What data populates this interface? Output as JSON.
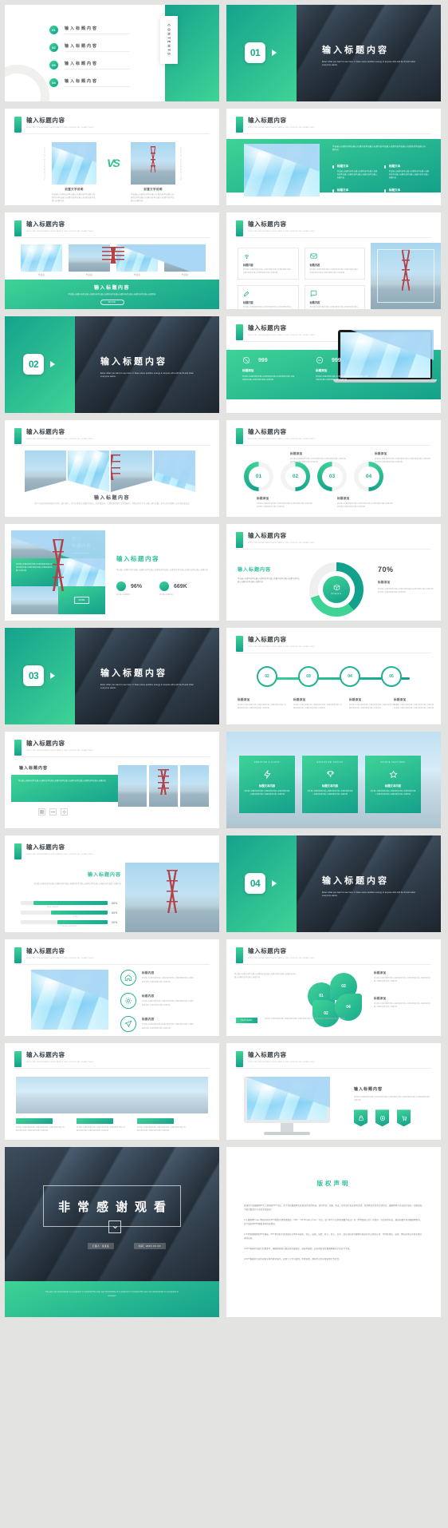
{
  "meta": {
    "accent": "#22b195",
    "accent_dark": "#13a08c",
    "accent_light": "#3fd396",
    "page_bg": "#e3e3e1"
  },
  "common": {
    "title_cn": "输入标题内容",
    "subtitle_en": "enter the presentation and make it into a forms for reader here",
    "caption_cn": "标题内容",
    "label_cn": "前置文字说明",
    "body_cn": "单击输入标题内容单击输入标题内容单击输入标题内容单击输入标题内容单击输入标题内容单击输入标题内容",
    "body_en": "Enter what you want to see here. It have some positive energy in anyone who will be fit and what everyone wants.",
    "more_btn": "MORE"
  },
  "slides": [
    {
      "id": "contents",
      "name": "contents-slide",
      "side_label": "CONTENTS",
      "items": [
        {
          "num": "01",
          "label": "输入标题内容"
        },
        {
          "num": "02",
          "label": "输入标题内容"
        },
        {
          "num": "03",
          "label": "输入标题内容"
        },
        {
          "num": "04",
          "label": "输入标题内容"
        }
      ]
    },
    {
      "id": "section-01",
      "name": "section-divider-01",
      "num": "01",
      "title": "输入标题内容",
      "desc": "Enter what you want to see here. It have some positive energy in anyone who will be fit and what everyone wants."
    },
    {
      "id": "vs",
      "name": "comparison-vs-slide",
      "title": "输入标题内容",
      "vs": "VS",
      "left_caption": "前置文字说明",
      "right_caption": "前置文字说明",
      "side_left": "Enter the presentation title",
      "side_right": "Enter the presentation title"
    },
    {
      "id": "img-text-4pt",
      "name": "image-with-four-points-slide",
      "title": "输入标题内容",
      "points": [
        {
          "label": "标题文本"
        },
        {
          "label": "标题文本"
        },
        {
          "label": "标题文本"
        },
        {
          "label": "标题文本"
        }
      ]
    },
    {
      "id": "four-thumbs",
      "name": "four-thumbnails-slide",
      "title": "输入标题内容",
      "captions": [
        "代表名",
        "代表名",
        "代表名",
        "代表名"
      ],
      "banner_title": "输入标题内容",
      "banner_btn": "MORE"
    },
    {
      "id": "icon-grid",
      "name": "icon-grid-slide",
      "title": "输入标题内容",
      "cells": [
        {
          "icon": "wifi-icon",
          "label": "标题内容"
        },
        {
          "icon": "mail-icon",
          "label": "标题内容"
        },
        {
          "icon": "edit-icon",
          "label": "标题内容"
        },
        {
          "icon": "chat-icon",
          "label": "标题内容"
        }
      ]
    },
    {
      "id": "section-02",
      "name": "section-divider-02",
      "num": "02",
      "title": "输入标题内容"
    },
    {
      "id": "laptop",
      "name": "laptop-mockup-slide",
      "title": "输入标题内容",
      "stats": [
        {
          "icon": "target-icon",
          "value": "999",
          "label": "标题添加"
        },
        {
          "icon": "minus-circle-icon",
          "value": "999",
          "label": "标题添加"
        }
      ]
    },
    {
      "id": "angled-photos",
      "name": "angled-photo-strip-slide",
      "title": "输入标题内容",
      "caption": "输入标题内容",
      "desc": "用户可以在放映放映幻灯片机上进行演示，也可以将演示文稿打印出来，制作成胶片，以便应用到更广泛的领域中，利用幻灯片中可以插入演示文稿，还可以在互联网上召开面对面会议"
    },
    {
      "id": "semi-donuts",
      "name": "semicircle-progress-slide",
      "title": "输入标题内容",
      "items": [
        {
          "num": "01",
          "label": "标题添加",
          "pos": "bottom"
        },
        {
          "num": "02",
          "label": "标题添加",
          "pos": "top"
        },
        {
          "num": "03",
          "label": "标题添加",
          "pos": "bottom"
        },
        {
          "num": "04",
          "label": "标题添加",
          "pos": "top"
        }
      ]
    },
    {
      "id": "mosaic",
      "name": "mosaic-stats-slide",
      "tile_title": "输入\n标题内容",
      "title": "输入标题内容",
      "stats": [
        {
          "icon": "leaf-icon",
          "value": "96%",
          "label": "单击输入标题内容"
        },
        {
          "icon": "chart-icon",
          "value": "669K",
          "label": "单击输入标题内容"
        }
      ]
    },
    {
      "id": "donut70",
      "name": "donut-chart-slide",
      "title": "输入标题内容",
      "left_heading": "输入标题内容",
      "percent": "70%",
      "center_label": "Analysis",
      "right_label": "标题添加"
    },
    {
      "id": "section-03",
      "name": "section-divider-03",
      "num": "03",
      "title": "输入标题内容"
    },
    {
      "id": "chain",
      "name": "linked-circles-slide",
      "title": "输入标题内容",
      "nodes": [
        {
          "num": "02",
          "label": "标题添加"
        },
        {
          "num": "03",
          "label": "标题添加"
        },
        {
          "num": "04",
          "label": "标题添加"
        },
        {
          "num": "05",
          "label": "标题添加"
        }
      ]
    },
    {
      "id": "text-photos",
      "name": "text-with-photo-strip-slide",
      "title": "输入标题内容",
      "sub_title": "输入标题内容",
      "controls": [
        "grid-icon",
        "arrows-icon",
        "gear-icon"
      ]
    },
    {
      "id": "three-cards",
      "name": "three-feature-cards-slide",
      "cards": [
        {
          "en": "CREATIVE & CLEAN",
          "icon": "bolt-icon",
          "label": "标题文本内容"
        },
        {
          "en": "EXCLUSIVE DESIGN",
          "icon": "trophy-icon",
          "label": "标题文本内容"
        },
        {
          "en": "UNIQUE FEATURES",
          "icon": "star-icon",
          "label": "标题文本内容"
        }
      ]
    },
    {
      "id": "bars",
      "name": "progress-bars-slide",
      "title": "输入标题内容",
      "heading": "输入标题内容",
      "bars": [
        {
          "label": "单击输入标题内容",
          "value": "85%",
          "pct": 85
        },
        {
          "label": "单击输入",
          "value": "65%",
          "pct": 65
        },
        {
          "label": "单击输入标题内容标题",
          "value": "50%",
          "pct": 50
        }
      ]
    },
    {
      "id": "section-04",
      "name": "section-divider-04",
      "num": "04",
      "title": "输入标题内容"
    },
    {
      "id": "photo-three-icons",
      "name": "photo-with-icon-list-slide",
      "title": "输入标题内容",
      "rows": [
        {
          "icon": "home-icon",
          "label": "标题内容"
        },
        {
          "icon": "gear-icon",
          "label": "标题内容"
        },
        {
          "icon": "send-icon",
          "label": "标题内容"
        }
      ]
    },
    {
      "id": "flower",
      "name": "flower-diagram-slide",
      "title": "输入标题内容",
      "petals": [
        {
          "num": "01",
          "label": "标题添加"
        },
        {
          "num": "03",
          "label": "标题添加"
        },
        {
          "num": "02",
          "label": "标题添加"
        },
        {
          "num": "04",
          "label": "标题添加"
        }
      ],
      "tag": "PARTERN"
    },
    {
      "id": "skyline",
      "name": "skyline-cards-slide",
      "title": "输入标题内容",
      "cards": [
        {
          "label": "标题内容"
        },
        {
          "label": "标题内容"
        },
        {
          "label": "标题内容"
        }
      ]
    },
    {
      "id": "monitor",
      "name": "monitor-mockup-slide",
      "title": "输入标题内容",
      "right_title": "输入标题内容",
      "badges": [
        "lock-icon",
        "coin-icon",
        "cart-icon"
      ]
    },
    {
      "id": "thanks",
      "name": "thank-you-slide",
      "title": "非常感谢观看",
      "buttons": [
        "汇报人：某某某",
        "时间：20XX.XX.XX"
      ],
      "footer": "The user can demonstrate on a projector or computerThe user can demonstrate on a projector or computerThe user can demonstrate on a projector or computer"
    },
    {
      "id": "copyright",
      "name": "copyright-statement-slide",
      "title": "版权声明",
      "paragraphs": [
        "感谢您下载摄图网平台上提供的PPT作品，为了您和摄图网以及原创作者的利益，请勿复制、传播、售卖、甚至进行商业盈利活动，否则将追究您的法律责任：摄图网将对作品进行维权，按照侵权下载次数进行十倍的罚款赔偿！",
        "1.在摄图网станет网站内所有PPT模板均是免费版权（VRF：VIP Royalty-Free）作品，受《中华人民共和国著作权法》和《世界版权公约》的保护。作品的所有权、版权和著作权归摄图网所有，您下载的是PPT模板素材的使用权。",
        "2.不得将摄图网的PPT模板、PPT素材的全部或部分分用于再出售、转让、出租、出借、转让、转让、分享、发布或任何可解释为直接竞争方式的方式、不得转授权、出售、网站其他公众者非供应中的权利。",
        "3.PPT模板中的图片仅供参考，摄图网提供大量高清正版图库，链接等配置，如有需要请至摄图网相关栏目自行下载。",
        "4.PPT模板中包含的创意字体为参考展示，仅供个人学习使用，不得商用，网站不对您字体使用行为负责。"
      ]
    }
  ]
}
